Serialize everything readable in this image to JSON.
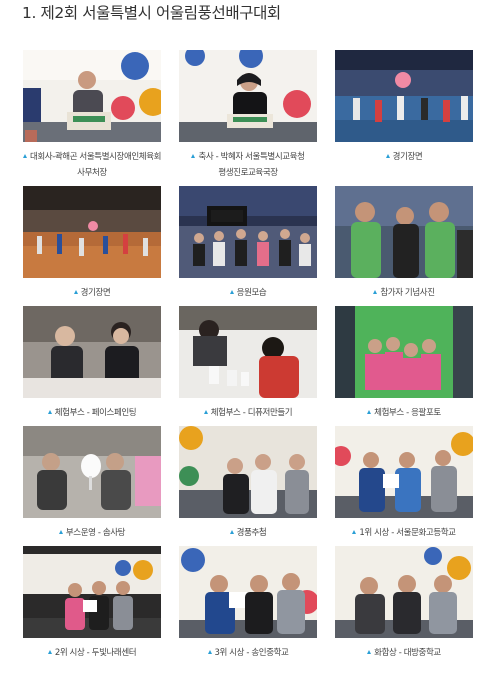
{
  "page": {
    "title": "1. 제2회 서울특별시 어울림풍선배구대회"
  },
  "gallery": {
    "items": [
      {
        "caption": "대회사-곽해곤 서울특별시장애인체육회 사무처장",
        "scene": "stage-speech-man"
      },
      {
        "caption": "축사 - 박혜자 서울특별시교육청 평생진로교육국장",
        "scene": "stage-speech-woman"
      },
      {
        "caption": "경기장면",
        "scene": "arena-match"
      },
      {
        "caption": "경기장면",
        "scene": "arena-wide"
      },
      {
        "caption": "응원모습",
        "scene": "cheering"
      },
      {
        "caption": "참가자 기념사진",
        "scene": "group-photo"
      },
      {
        "caption": "체험부스 - 페이스페인팅",
        "scene": "face-painting"
      },
      {
        "caption": "체험부스 - 디퓨저만들기",
        "scene": "diffuser"
      },
      {
        "caption": "체험부스 - 응팔포토",
        "scene": "photo-booth"
      },
      {
        "caption": "부스운영 - 솜사탕",
        "scene": "cotton-candy"
      },
      {
        "caption": "경품추첨",
        "scene": "prize-draw"
      },
      {
        "caption": "1위 시상 - 서울문화고등학교",
        "scene": "award-1st"
      },
      {
        "caption": "2위 시상 - 두빛나래센터",
        "scene": "award-2nd"
      },
      {
        "caption": "3위 시상 - 송인중학교",
        "scene": "award-3rd"
      },
      {
        "caption": "화합상 - 대방중학교",
        "scene": "award-harmony"
      }
    ]
  }
}
